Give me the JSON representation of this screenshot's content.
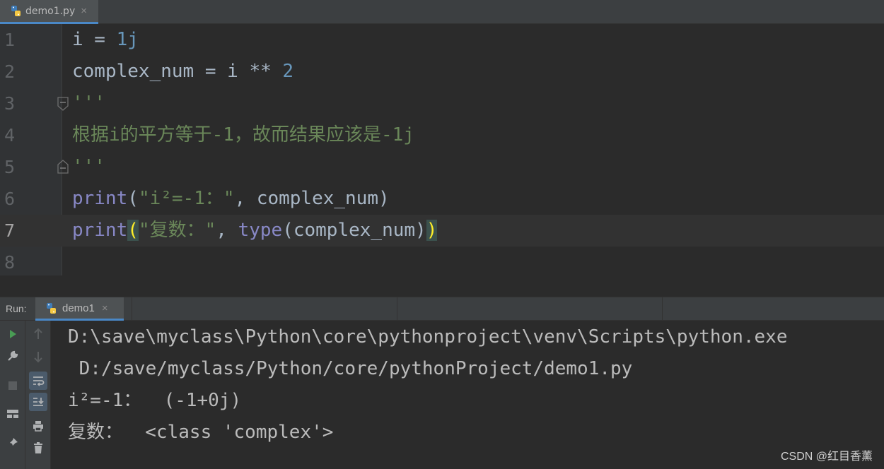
{
  "editor_tab": {
    "file_name": "demo1.py",
    "close": "×"
  },
  "editor": {
    "line_numbers": [
      "1",
      "2",
      "3",
      "4",
      "5",
      "6",
      "7",
      "8"
    ],
    "current_line": 7,
    "lines": [
      [
        {
          "t": "i = ",
          "c": "plain"
        },
        {
          "t": "1j",
          "c": "num"
        }
      ],
      [
        {
          "t": "complex_num = i ** ",
          "c": "plain"
        },
        {
          "t": "2",
          "c": "num"
        }
      ],
      [
        {
          "t": "'''",
          "c": "str"
        }
      ],
      [
        {
          "t": "根据i的平方等于-1，故而结果应该是-1j",
          "c": "str"
        }
      ],
      [
        {
          "t": "'''",
          "c": "str"
        }
      ],
      [
        {
          "t": "print",
          "c": "fn"
        },
        {
          "t": "(",
          "c": "plain"
        },
        {
          "t": "\"i²=-1：\"",
          "c": "str"
        },
        {
          "t": ", complex_num)",
          "c": "plain"
        }
      ],
      [
        {
          "t": "print",
          "c": "fn"
        },
        {
          "t": "(",
          "c": "bracehl"
        },
        {
          "t": "\"复数：\"",
          "c": "str"
        },
        {
          "t": ", ",
          "c": "plain"
        },
        {
          "t": "type",
          "c": "fn"
        },
        {
          "t": "(complex_num)",
          "c": "plain"
        },
        {
          "t": ")",
          "c": "bracehl"
        }
      ],
      []
    ]
  },
  "run_panel": {
    "label": "Run:",
    "tab_name": "demo1",
    "close": "×",
    "console_lines": [
      "D:\\save\\myclass\\Python\\core\\pythonproject\\venv\\Scripts\\python.exe",
      " D:/save/myclass/Python/core/pythonProject/demo1.py",
      "i²=-1：  (-1+0j)",
      "复数：  <class 'complex'>"
    ],
    "left_tools": [
      "run-icon",
      "wrench-icon",
      "stop-icon",
      "layout-icon",
      "pin-icon"
    ],
    "right_tools": [
      "up-arrow-icon",
      "down-arrow-icon",
      "soft-wrap-icon",
      "scroll-to-end-icon",
      "print-icon",
      "trash-icon"
    ]
  },
  "watermark": "CSDN @红目香薰",
  "colors": {
    "keyword_fn": "#8888c6",
    "string": "#6a8759",
    "number": "#6897bb",
    "text": "#a9b7c6"
  }
}
